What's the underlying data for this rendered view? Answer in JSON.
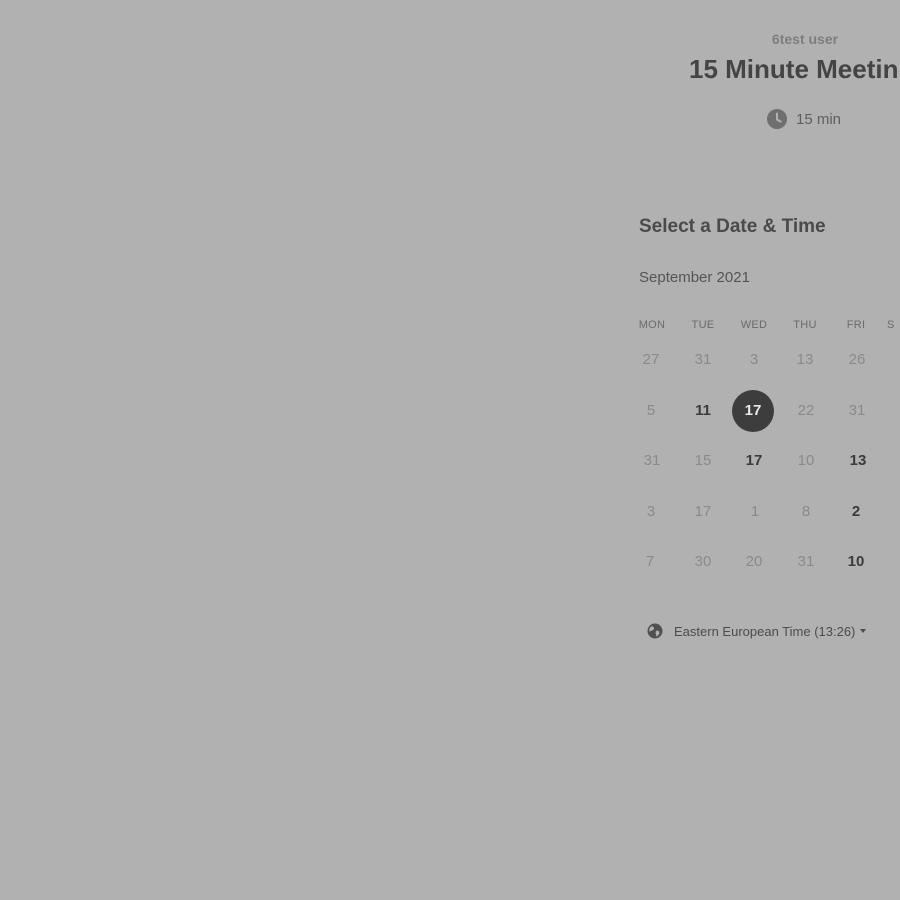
{
  "event": {
    "host": "6test user",
    "title": "15 Minute Meetin",
    "duration": "15 min"
  },
  "calendar": {
    "heading": "Select a Date & Time",
    "month": "September 2021",
    "weekdays": [
      "MON",
      "TUE",
      "WED",
      "THU",
      "FRI",
      "S"
    ],
    "weeks": [
      [
        {
          "label": "27",
          "state": "unavailable"
        },
        {
          "label": "31",
          "state": "unavailable"
        },
        {
          "label": "3",
          "state": "unavailable"
        },
        {
          "label": "13",
          "state": "unavailable"
        },
        {
          "label": "26",
          "state": "unavailable"
        }
      ],
      [
        {
          "label": "5",
          "state": "unavailable"
        },
        {
          "label": "11",
          "state": "available"
        },
        {
          "label": "17",
          "state": "selected"
        },
        {
          "label": "22",
          "state": "unavailable"
        },
        {
          "label": "31",
          "state": "unavailable"
        }
      ],
      [
        {
          "label": "31",
          "state": "unavailable"
        },
        {
          "label": "15",
          "state": "unavailable"
        },
        {
          "label": "17",
          "state": "available"
        },
        {
          "label": "10",
          "state": "unavailable"
        },
        {
          "label": "13",
          "state": "available"
        }
      ],
      [
        {
          "label": "3",
          "state": "unavailable"
        },
        {
          "label": "17",
          "state": "unavailable"
        },
        {
          "label": "1",
          "state": "unavailable"
        },
        {
          "label": "8",
          "state": "unavailable"
        },
        {
          "label": "2",
          "state": "available"
        }
      ],
      [
        {
          "label": "7",
          "state": "unavailable"
        },
        {
          "label": "30",
          "state": "unavailable"
        },
        {
          "label": "20",
          "state": "unavailable"
        },
        {
          "label": "31",
          "state": "unavailable"
        },
        {
          "label": "10",
          "state": "available"
        }
      ]
    ]
  },
  "timezone": {
    "label": "Eastern European Time (13:26)",
    "icon": "globe-icon"
  },
  "colors": {
    "overlay_background": "#b1b1b1",
    "selected_day": "#3d3d3d"
  }
}
